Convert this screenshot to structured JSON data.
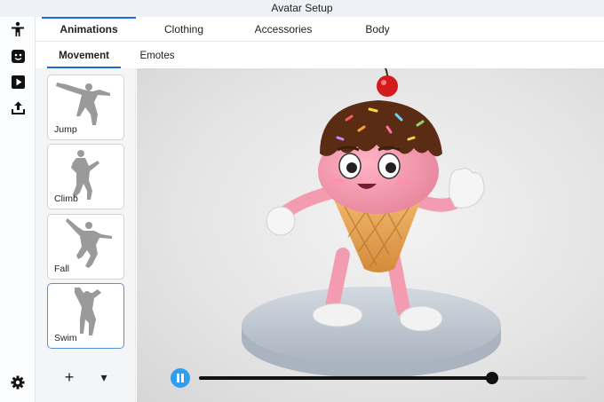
{
  "window": {
    "title": "Avatar Setup"
  },
  "rail": {
    "top_icons": [
      "person-icon",
      "face-icon",
      "play-square-icon",
      "upload-icon"
    ],
    "bottom_icon": "gear-icon"
  },
  "tabs": [
    {
      "label": "Animations",
      "active": true
    },
    {
      "label": "Clothing",
      "active": false
    },
    {
      "label": "Accessories",
      "active": false
    },
    {
      "label": "Body",
      "active": false
    }
  ],
  "subtabs": [
    {
      "label": "Movement",
      "active": true
    },
    {
      "label": "Emotes",
      "active": false
    }
  ],
  "animations": [
    {
      "label": "Jump",
      "selected": false
    },
    {
      "label": "Climb",
      "selected": false
    },
    {
      "label": "Fall",
      "selected": false
    },
    {
      "label": "Swim",
      "selected": true
    }
  ],
  "panel_controls": {
    "add": "+",
    "dropdown": "▾"
  },
  "playback": {
    "state": "playing",
    "progress": 0.756
  },
  "colors": {
    "accent": "#1f6bd6",
    "play_button": "#2f9df0"
  }
}
